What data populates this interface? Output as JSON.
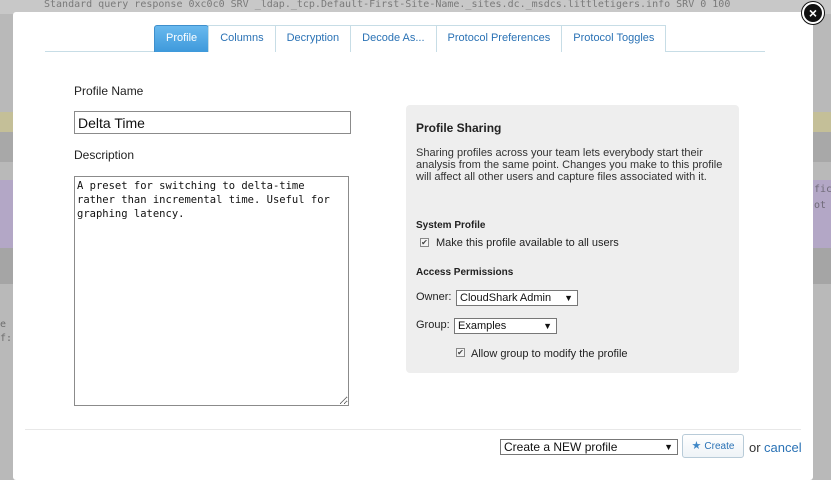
{
  "background": {
    "top_line": "Standard query response 0xc0c0 SRV _ldap._tcp.Default-First-Site-Name._sites.dc._msdcs.littletigers.info SRV 0 100",
    "left_fragment": [
      "e",
      "f:"
    ],
    "right_fragment": [
      "fic",
      "ot"
    ]
  },
  "modal": {
    "close_label": "×",
    "tabs": [
      {
        "label": "Profile",
        "active": true
      },
      {
        "label": "Columns",
        "active": false
      },
      {
        "label": "Decryption",
        "active": false
      },
      {
        "label": "Decode As...",
        "active": false
      },
      {
        "label": "Protocol Preferences",
        "active": false
      },
      {
        "label": "Protocol Toggles",
        "active": false
      }
    ],
    "profile_name_label": "Profile Name",
    "profile_name_value": "Delta Time",
    "description_label": "Description",
    "description_value": "A preset for switching to delta-time rather than incremental time. Useful for graphing latency.",
    "sharing": {
      "title": "Profile Sharing",
      "text": "Sharing profiles across your team lets everybody start their analysis from the same point. Changes you make to this profile will affect all other users and capture files associated with it.",
      "system_profile_title": "System Profile",
      "system_profile_checkbox": "Make this profile available to all users",
      "system_profile_checked": true,
      "access_title": "Access Permissions",
      "owner_label": "Owner:",
      "owner_value": "CloudShark Admin",
      "group_label": "Group:",
      "group_value": "Examples",
      "group_modify_checkbox": "Allow group to modify the profile",
      "group_modify_checked": true
    },
    "footer": {
      "create_select_value": "Create a NEW profile",
      "create_button": "Create",
      "or_text": "or",
      "cancel_link": "cancel"
    }
  },
  "icons": {
    "close": "close-icon",
    "star": "star-icon",
    "check": "check-icon",
    "dropdown": "caret-down-icon"
  }
}
